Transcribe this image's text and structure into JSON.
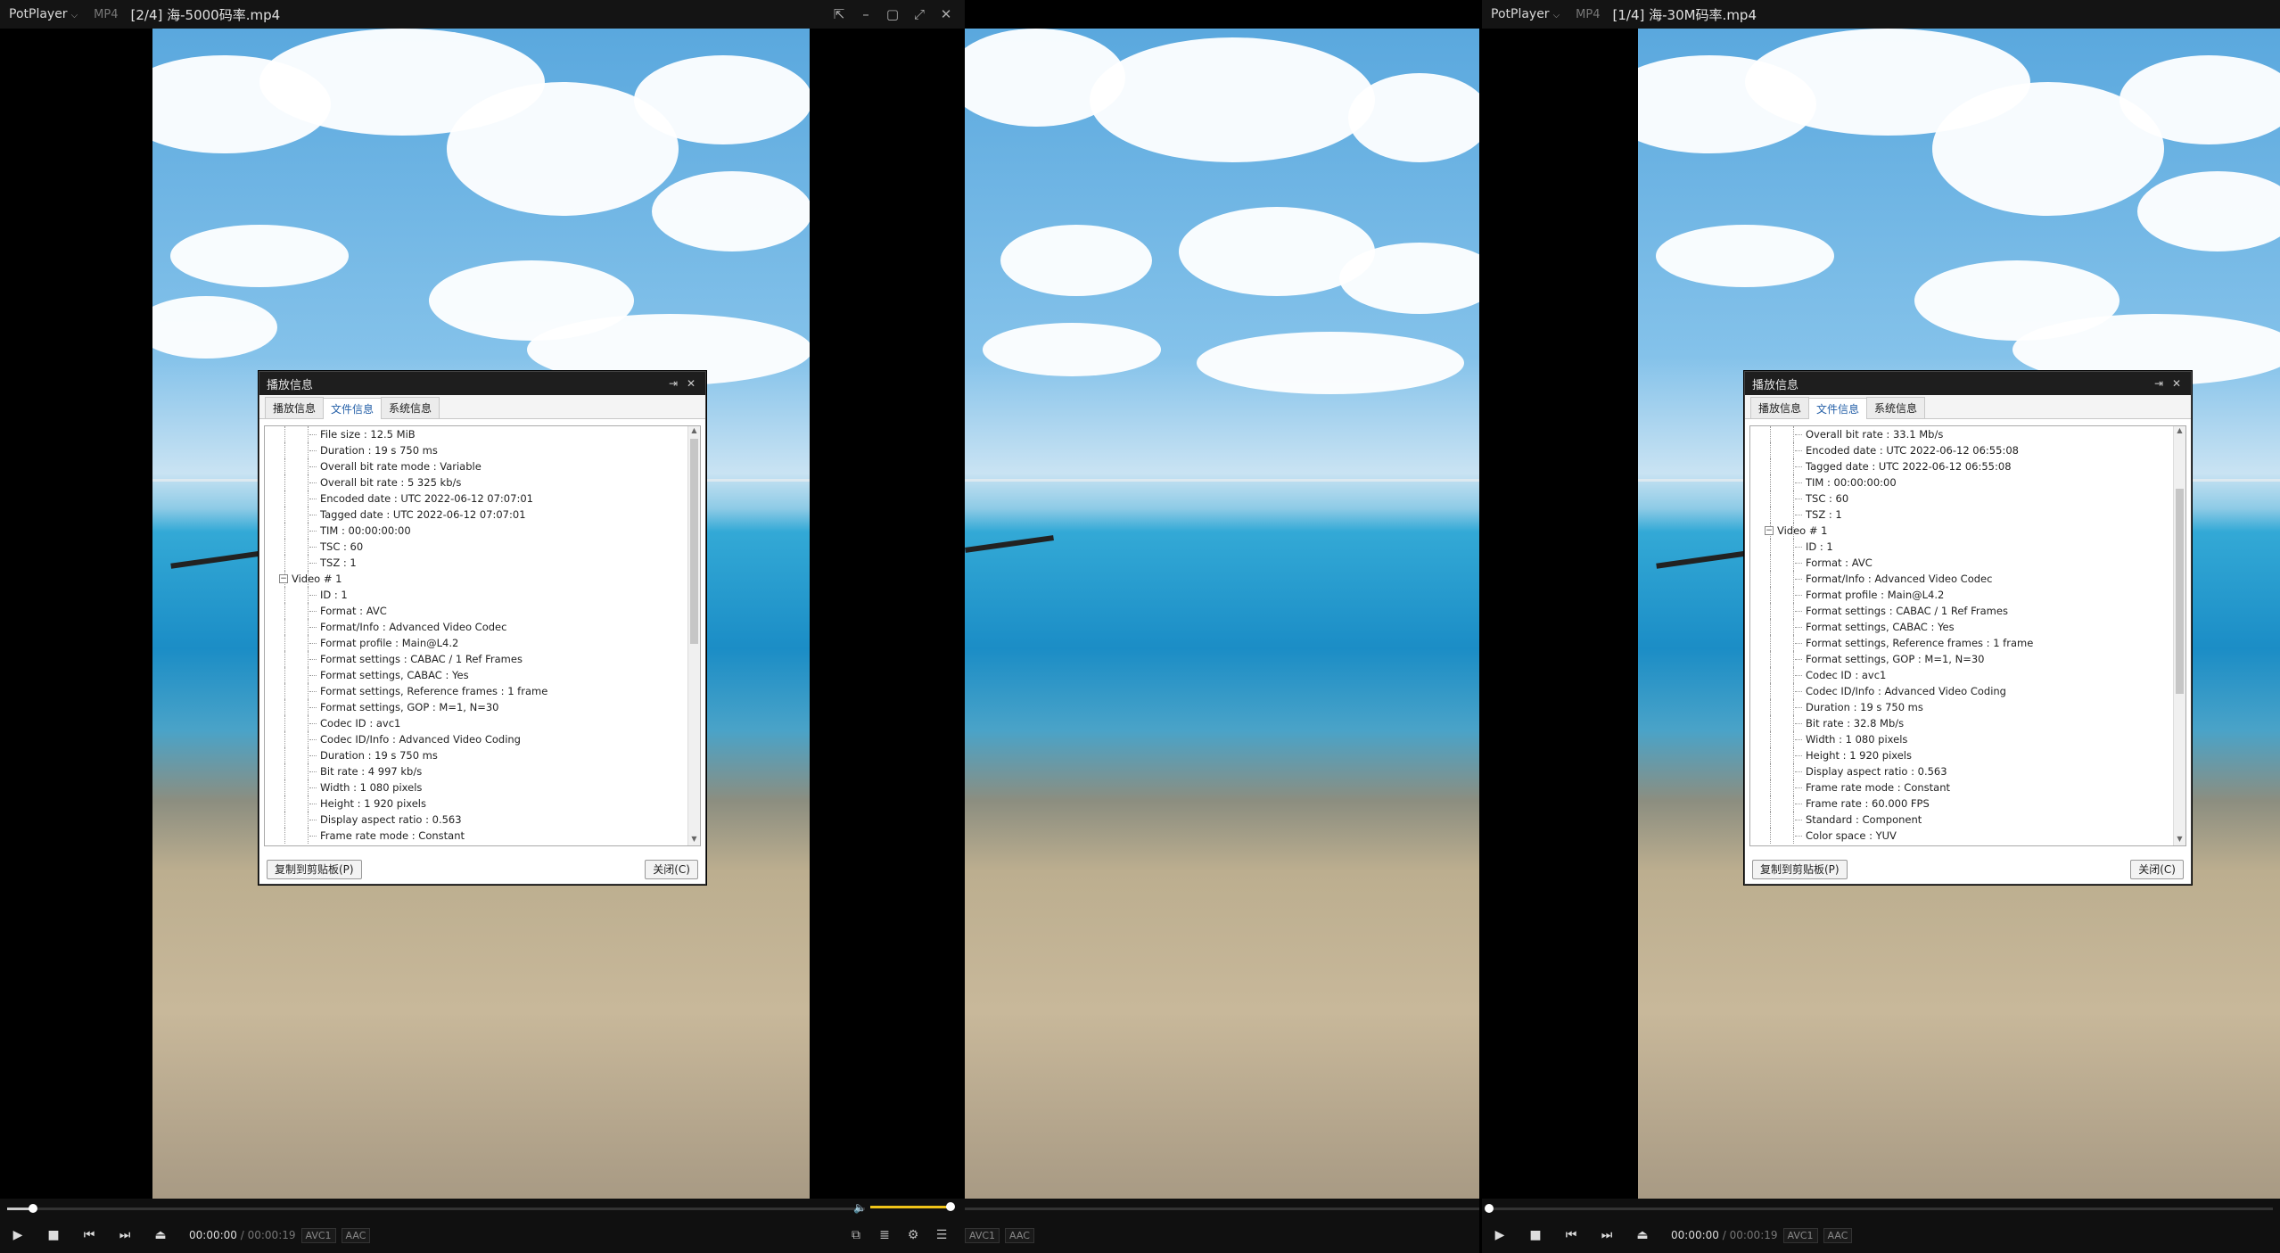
{
  "players": {
    "left": {
      "brand": "PotPlayer",
      "format": "MP4",
      "filename": "[2/4] 海-5000码率.mp4",
      "time_current": "00:00:00",
      "time_sep": "/",
      "time_total": "00:00:19",
      "badge_video": "AVC1",
      "badge_audio": "AAC",
      "seek_progress": 0.03,
      "volume_level": 1.0
    },
    "middle": {
      "badge_video": "AVC1",
      "badge_audio": "AAC"
    },
    "right": {
      "brand": "PotPlayer",
      "format": "MP4",
      "filename": "[1/4] 海-30M码率.mp4",
      "time_current": "00:00:00",
      "time_sep": "/",
      "time_total": "00:00:19",
      "badge_video": "AVC1",
      "badge_audio": "AAC",
      "seek_progress": 0.0
    }
  },
  "dialog_left": {
    "title": "播放信息",
    "tabs": [
      "播放信息",
      "文件信息",
      "系统信息"
    ],
    "active_tab": 1,
    "copy_button": "复制到剪贴板(P)",
    "close_button": "关闭(C)",
    "rows": [
      {
        "text": "File size : 12.5 MiB",
        "level": 2
      },
      {
        "text": "Duration : 19 s 750 ms",
        "level": 2
      },
      {
        "text": "Overall bit rate mode : Variable",
        "level": 2
      },
      {
        "text": "Overall bit rate : 5 325 kb/s",
        "level": 2
      },
      {
        "text": "Encoded date : UTC 2022-06-12 07:07:01",
        "level": 2
      },
      {
        "text": "Tagged date : UTC 2022-06-12 07:07:01",
        "level": 2
      },
      {
        "text": "TIM : 00:00:00:00",
        "level": 2
      },
      {
        "text": "TSC : 60",
        "level": 2
      },
      {
        "text": "TSZ : 1",
        "level": 2
      },
      {
        "text": "Video # 1",
        "level": 1,
        "expander": "−"
      },
      {
        "text": "ID : 1",
        "level": 2
      },
      {
        "text": "Format : AVC",
        "level": 2
      },
      {
        "text": "Format/Info : Advanced Video Codec",
        "level": 2
      },
      {
        "text": "Format profile : Main@L4.2",
        "level": 2
      },
      {
        "text": "Format settings : CABAC / 1 Ref Frames",
        "level": 2
      },
      {
        "text": "Format settings, CABAC : Yes",
        "level": 2
      },
      {
        "text": "Format settings, Reference frames : 1 frame",
        "level": 2
      },
      {
        "text": "Format settings, GOP : M=1, N=30",
        "level": 2
      },
      {
        "text": "Codec ID : avc1",
        "level": 2
      },
      {
        "text": "Codec ID/Info : Advanced Video Coding",
        "level": 2
      },
      {
        "text": "Duration : 19 s 750 ms",
        "level": 2
      },
      {
        "text": "Bit rate : 4 997 kb/s",
        "level": 2
      },
      {
        "text": "Width : 1 080 pixels",
        "level": 2
      },
      {
        "text": "Height : 1 920 pixels",
        "level": 2
      },
      {
        "text": "Display aspect ratio : 0.563",
        "level": 2
      },
      {
        "text": "Frame rate mode : Constant",
        "level": 2
      }
    ]
  },
  "dialog_right": {
    "title": "播放信息",
    "tabs": [
      "播放信息",
      "文件信息",
      "系统信息"
    ],
    "active_tab": 1,
    "copy_button": "复制到剪贴板(P)",
    "close_button": "关闭(C)",
    "rows": [
      {
        "text": "Overall bit rate : 33.1 Mb/s",
        "level": 2
      },
      {
        "text": "Encoded date : UTC 2022-06-12 06:55:08",
        "level": 2
      },
      {
        "text": "Tagged date : UTC 2022-06-12 06:55:08",
        "level": 2
      },
      {
        "text": "TIM : 00:00:00:00",
        "level": 2
      },
      {
        "text": "TSC : 60",
        "level": 2
      },
      {
        "text": "TSZ : 1",
        "level": 2
      },
      {
        "text": "Video # 1",
        "level": 1,
        "expander": "−"
      },
      {
        "text": "ID : 1",
        "level": 2
      },
      {
        "text": "Format : AVC",
        "level": 2
      },
      {
        "text": "Format/Info : Advanced Video Codec",
        "level": 2
      },
      {
        "text": "Format profile : Main@L4.2",
        "level": 2
      },
      {
        "text": "Format settings : CABAC / 1 Ref Frames",
        "level": 2
      },
      {
        "text": "Format settings, CABAC : Yes",
        "level": 2
      },
      {
        "text": "Format settings, Reference frames : 1 frame",
        "level": 2
      },
      {
        "text": "Format settings, GOP : M=1, N=30",
        "level": 2
      },
      {
        "text": "Codec ID : avc1",
        "level": 2
      },
      {
        "text": "Codec ID/Info : Advanced Video Coding",
        "level": 2
      },
      {
        "text": "Duration : 19 s 750 ms",
        "level": 2
      },
      {
        "text": "Bit rate : 32.8 Mb/s",
        "level": 2
      },
      {
        "text": "Width : 1 080 pixels",
        "level": 2
      },
      {
        "text": "Height : 1 920 pixels",
        "level": 2
      },
      {
        "text": "Display aspect ratio : 0.563",
        "level": 2
      },
      {
        "text": "Frame rate mode : Constant",
        "level": 2
      },
      {
        "text": "Frame rate : 60.000 FPS",
        "level": 2
      },
      {
        "text": "Standard : Component",
        "level": 2
      },
      {
        "text": "Color space : YUV",
        "level": 2
      }
    ]
  },
  "icons": {
    "play": "▶",
    "stop": "■",
    "prev": "⏮",
    "next": "⏭",
    "eject": "⏏",
    "volume": "🔈",
    "pin": "⇱",
    "minimize": "–",
    "maximize": "▢",
    "fullscreen": "⤢",
    "close": "✕",
    "caret": "⌵",
    "subtitle": "⧉",
    "playlist": "≣",
    "settings": "⚙",
    "menu": "☰",
    "dialog_pin": "⇥",
    "dialog_close": "✕",
    "scroll_up": "▲",
    "scroll_down": "▼"
  }
}
